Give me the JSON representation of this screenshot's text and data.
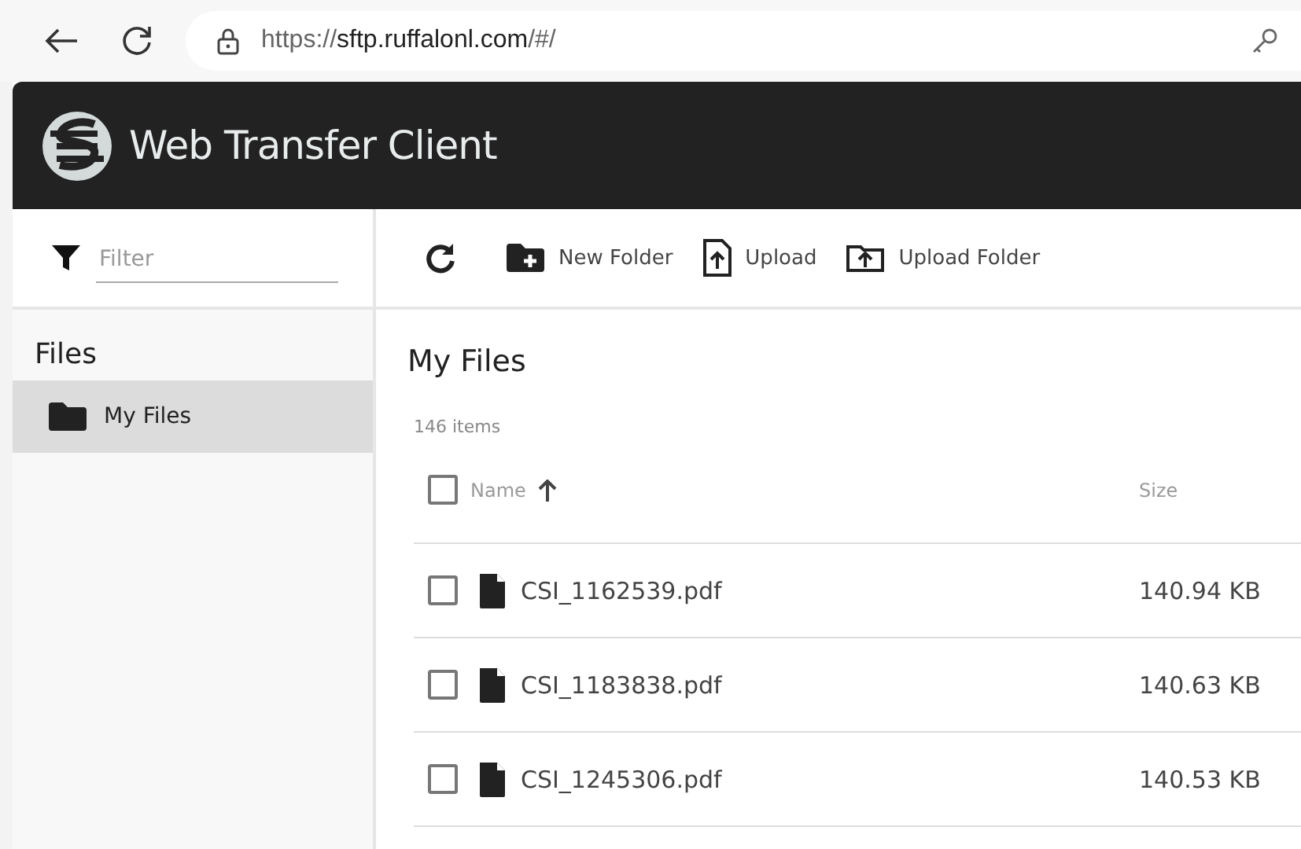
{
  "browser": {
    "url_scheme": "https://",
    "url_host": "sftp.ruffalonl.com",
    "url_path": "/#/"
  },
  "app": {
    "title": "Web Transfer Client"
  },
  "sidebar": {
    "filter": {
      "placeholder": "Filter"
    },
    "section": "Files",
    "items": [
      {
        "label": "My Files",
        "selected": true
      }
    ]
  },
  "toolbar": {
    "buttons": [
      {
        "kind": "new-folder",
        "label": "New Folder"
      },
      {
        "kind": "upload",
        "label": "Upload"
      },
      {
        "kind": "upload-folder",
        "label": "Upload Folder"
      }
    ]
  },
  "content": {
    "title": "My Files",
    "count": "146 items",
    "table": {
      "select_all": {
        "checked": false
      },
      "columns": [
        "Name",
        "Size"
      ],
      "rows": [
        {
          "name": "CSI_1162539.pdf",
          "size": "140.94 KB",
          "checked": false
        },
        {
          "name": "CSI_1183838.pdf",
          "size": "140.63 KB",
          "checked": false
        },
        {
          "name": "CSI_1245306.pdf",
          "size": "140.53 KB",
          "checked": false
        }
      ]
    }
  }
}
